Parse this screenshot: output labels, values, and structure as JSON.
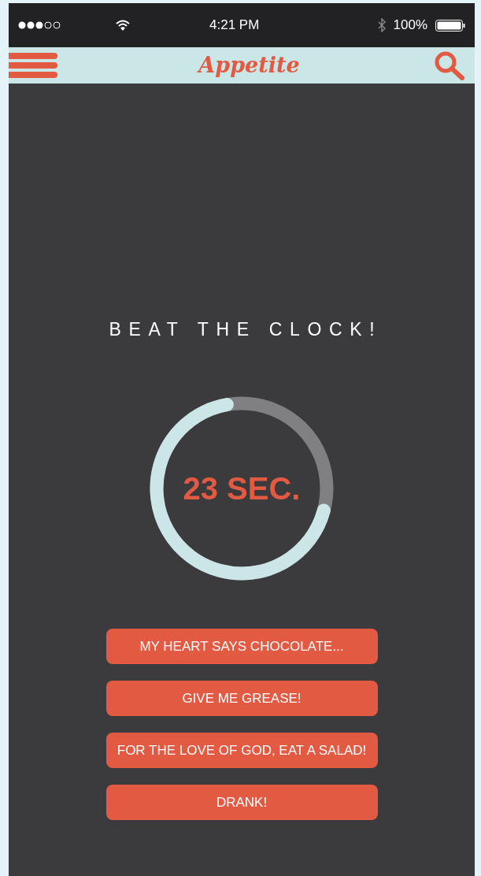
{
  "status_bar": {
    "time": "4:21 PM",
    "battery": "100%"
  },
  "nav_bar": {
    "logo": "Appetite"
  },
  "heading": "BEAT THE CLOCK!",
  "timer": {
    "reading": "23 SEC."
  },
  "buttons": [
    {
      "label": "MY HEART SAYS CHOCOLATE..."
    },
    {
      "label": "GIVE ME GREASE!"
    },
    {
      "label": "FOR THE LOVE OF GOD, EAT A SALAD!"
    },
    {
      "label": "DRANK!"
    }
  ]
}
